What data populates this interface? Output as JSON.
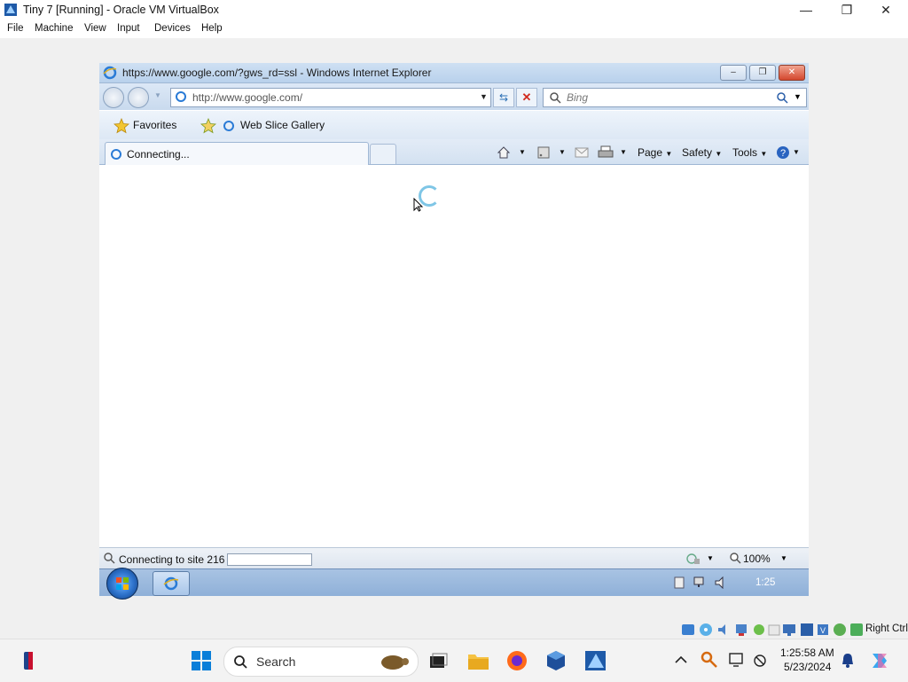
{
  "host": {
    "window_title": "Tiny 7 [Running] - Oracle VM VirtualBox",
    "menu": [
      "File",
      "Machine",
      "View",
      "Input",
      "Devices",
      "Help"
    ],
    "right_ctrl_label": "Right Ctrl"
  },
  "ie": {
    "title": "https://www.google.com/?gws_rd=ssl - Windows Internet Explorer",
    "address": "http://www.google.com/",
    "search_placeholder": "Bing",
    "favorites_label": "Favorites",
    "web_slice_label": "Web Slice Gallery",
    "active_tab_label": "Connecting...",
    "commands": {
      "page": "Page",
      "safety": "Safety",
      "tools": "Tools"
    },
    "status_text": "Connecting to site 216",
    "zoom": "100%"
  },
  "guest_taskbar": {
    "clock": "1:25"
  },
  "host_taskbar": {
    "search_label": "Search",
    "time": "1:25:58 AM",
    "date": "5/23/2024"
  },
  "colors": {
    "ie_chrome": "#c9daee",
    "guest_taskbar": "#8fb0d8",
    "host_taskbar": "#f3f3f3"
  }
}
